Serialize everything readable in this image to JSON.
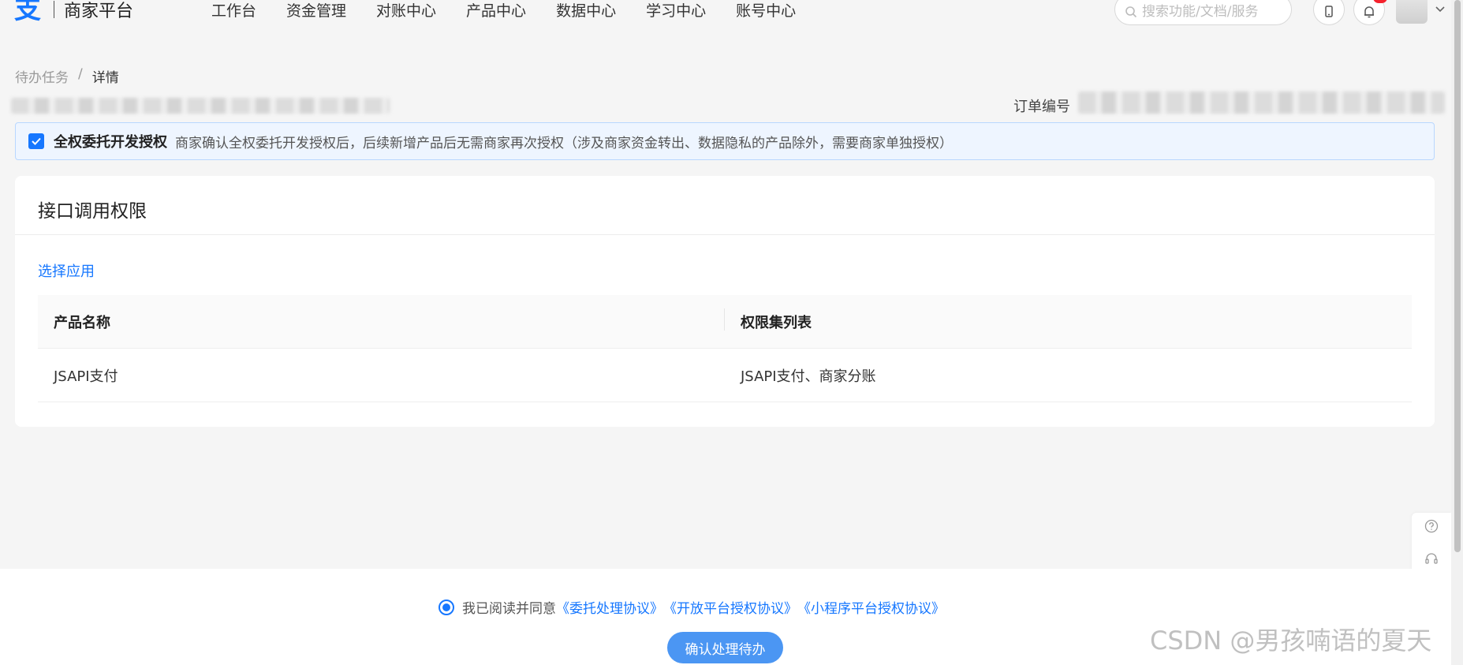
{
  "header": {
    "logo_mark": "支",
    "logo_text": "商家平台",
    "nav": [
      "工作台",
      "资金管理",
      "对账中心",
      "产品中心",
      "数据中心",
      "学习中心",
      "账号中心"
    ],
    "search_placeholder": "搜索功能/文档/服务"
  },
  "breadcrumb": {
    "parent": "待办任务",
    "separator": "/",
    "current": "详情"
  },
  "order": {
    "label": "订单编号"
  },
  "notice": {
    "title": "全权委托开发授权",
    "desc": "商家确认全权委托开发授权后，后续新增产品后无需商家再次授权（涉及商家资金转出、数据隐私的产品除外，需要商家单独授权）"
  },
  "card": {
    "title": "接口调用权限",
    "select_app": "选择应用",
    "columns": [
      "产品名称",
      "权限集列表"
    ],
    "rows": [
      {
        "product": "JSAPI支付",
        "permissions": "JSAPI支付、商家分账"
      }
    ]
  },
  "footer": {
    "agree_prefix": "我已阅读并同意",
    "links": [
      "《委托处理协议》",
      "《开放平台授权协议》",
      "《小程序平台授权协议》"
    ],
    "confirm": "确认处理待办"
  },
  "watermark": "CSDN @男孩喃语的夏天",
  "colors": {
    "accent": "#1677ff",
    "notice_bg": "#eef5ff",
    "badge": "#f5222d"
  }
}
